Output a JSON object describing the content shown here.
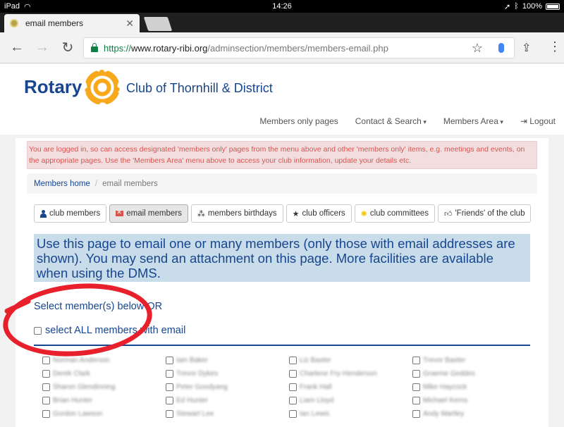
{
  "status": {
    "device": "iPad",
    "time": "14:26",
    "battery": "100%"
  },
  "browser": {
    "tab_title": "email members",
    "url": {
      "scheme": "https://",
      "host": "www.rotary-ribi.org",
      "path": "/adminsection/members/members-email.php"
    }
  },
  "site": {
    "logo_word": "Rotary",
    "club_name": "Club of Thornhill & District",
    "nav": [
      "Members only pages",
      "Contact & Search",
      "Members Area",
      "Logout"
    ]
  },
  "alert": "You are logged in, so can access designated 'members only' pages from the menu above and other 'members only' items, e.g. meetings and events, on the appropriate pages. Use the 'Members Area' menu above to access your club information, update your details etc.",
  "breadcrumb": {
    "home": "Members home",
    "current": "email members"
  },
  "buttons": [
    {
      "label": "club members",
      "icon": "person-icon"
    },
    {
      "label": "email members",
      "icon": "envelope-icon",
      "active": true
    },
    {
      "label": "members birthdays",
      "icon": "gift-icon"
    },
    {
      "label": "club officers",
      "icon": "star-icon"
    },
    {
      "label": "club committees",
      "icon": "sun-icon"
    },
    {
      "label": "'Friends' of the club",
      "icon": "thumbs-up-icon"
    }
  ],
  "info": "Use this page to email one or many members (only those with email addresses are shown). You may send an attachment on this page. More facilities are available when using the DMS.",
  "select_heading": "Select member(s) below OR",
  "select_all": "select ALL members with email",
  "members": [
    "Norman Anderson",
    "Iain Baker",
    "Liz Baxter",
    "Trevor Baxter",
    "Derek Clark",
    "Trevor Dykes",
    "Charlene Fry-Henderson",
    "Graeme Geddes",
    "Sharon Glendinning",
    "Peter Goodyang",
    "Frank Hall",
    "Mike Haycock",
    "Brian Hunter",
    "Ed Hunter",
    "Liam Lloyd",
    "Michael Kerns",
    "Gordon Lawson",
    "Stewart Lee",
    "Ian Lewis",
    "Andy Martley"
  ],
  "colors": {
    "rotary_blue": "#17458f",
    "rotary_gold": "#f7a81b",
    "alert_red": "#d9534f",
    "annotation_red": "#e8202c"
  }
}
